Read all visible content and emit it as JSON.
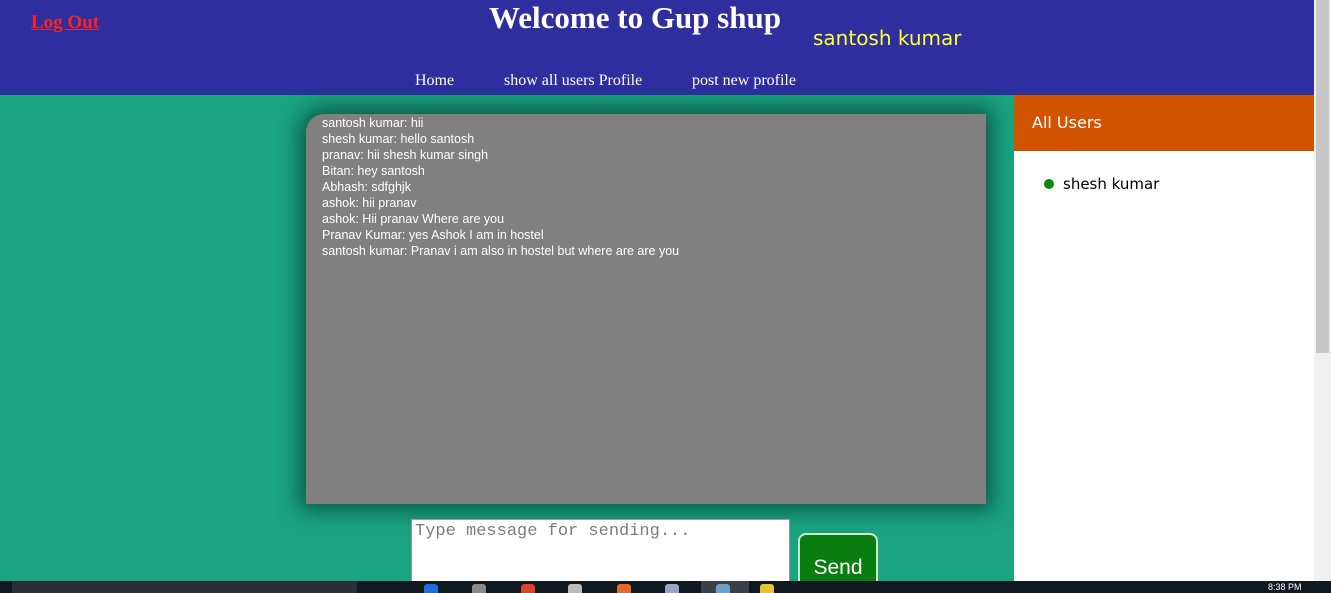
{
  "header": {
    "logout_label": "Log Out",
    "title": "Welcome to Gup shup",
    "username": "santosh kumar",
    "nav": {
      "home": "Home",
      "all_users": "show all users Profile",
      "post_profile": "post new profile"
    }
  },
  "chat": {
    "messages": [
      "santosh kumar: hii",
      "shesh kumar: hello santosh",
      "pranav: hii shesh kumar singh",
      "Bitan: hey santosh",
      "Abhash: sdfghjk",
      "ashok: hii pranav",
      "ashok: Hii pranav Where are you",
      "Pranav Kumar: yes Ashok I am in hostel",
      "santosh kumar: Pranav i am also in hostel but where are are you"
    ]
  },
  "composer": {
    "placeholder": "Type message for sending...",
    "value": "",
    "send_label": "Send"
  },
  "sidebar": {
    "heading": "All Users",
    "users": [
      {
        "name": "shesh kumar",
        "status_icon": "online-dot-icon",
        "status_color": "#0a8a0a"
      }
    ]
  },
  "colors": {
    "header_bg": "#2e2e9f",
    "page_bg": "#1aa481",
    "chat_bg": "#808080",
    "sidebar_head_bg": "#d35400",
    "send_bg": "#0a7d10",
    "logout": "#ff2020",
    "username": "#ffff33"
  },
  "taskbar": {
    "time": "8:38 PM"
  }
}
